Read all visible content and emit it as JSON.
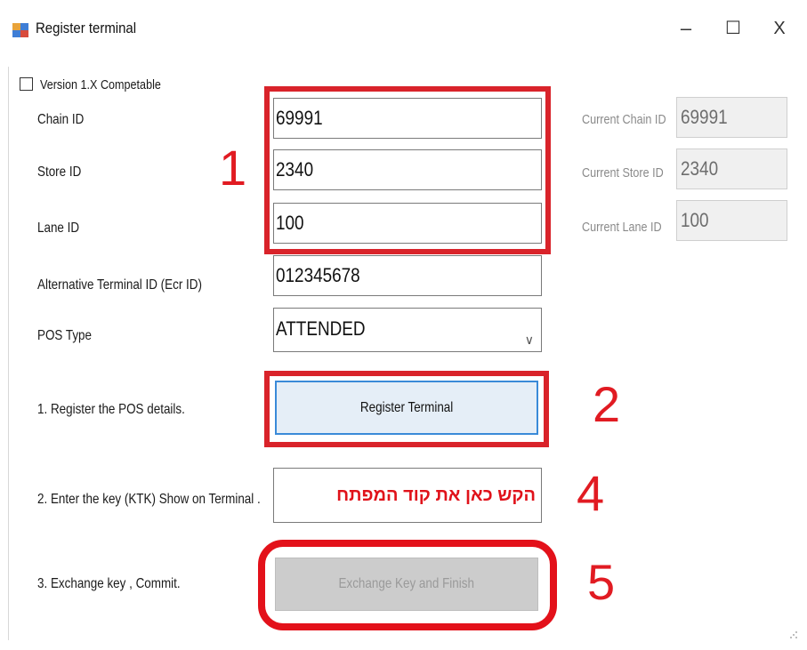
{
  "window": {
    "title": "Register terminal",
    "minimize_glyph": "–",
    "maximize_glyph": "☐",
    "close_glyph": "X",
    "icon": "app-window-icon"
  },
  "form": {
    "version_checkbox": {
      "label": "Version 1.X Competable",
      "checked": false
    },
    "chain_id": {
      "label": "Chain ID",
      "value": "69991"
    },
    "store_id": {
      "label": "Store ID",
      "value": "2340"
    },
    "lane_id": {
      "label": "Lane ID",
      "value": "100"
    },
    "alt_terminal_id": {
      "label": "Alternative Terminal ID (Ecr ID)",
      "value": "012345678"
    },
    "pos_type": {
      "label": "POS Type",
      "value": "ATTENDED"
    }
  },
  "current": {
    "chain_label": "Current Chain ID",
    "chain_value": "69991",
    "store_label": "Current Store ID",
    "store_value": "2340",
    "lane_label": "Current Lane ID",
    "lane_value": "100"
  },
  "steps": {
    "step1_label": "1. Register the POS details.",
    "register_button": "Register Terminal",
    "step2_label": "2. Enter the key (KTK) Show on Terminal .",
    "ktk_value": "הקש כאן את קוד המפתח",
    "step3_label": "3. Exchange key , Commit.",
    "exchange_button": "Exchange Key and Finish"
  },
  "annotations": {
    "n1": "1",
    "n2": "2",
    "n4": "4",
    "n5": "5",
    "color": "#e11b22"
  }
}
